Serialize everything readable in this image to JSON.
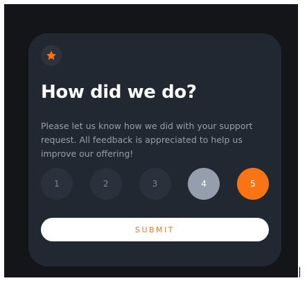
{
  "card": {
    "icon": "star-icon",
    "title": "How did we do?",
    "description": "Please let us know how we did with your support request. All feedback is appreciated to help us improve our offering!",
    "ratings": [
      "1",
      "2",
      "3",
      "4",
      "5"
    ],
    "hovered_rating": "4",
    "selected_rating": "5",
    "submit_label": "SUBMIT"
  },
  "colors": {
    "page_background": "#131519",
    "card_background": "#222832",
    "accent": "#fb7413",
    "rating_idle": "#2a313c",
    "rating_hover": "#959eac",
    "text_muted": "#969fad"
  }
}
